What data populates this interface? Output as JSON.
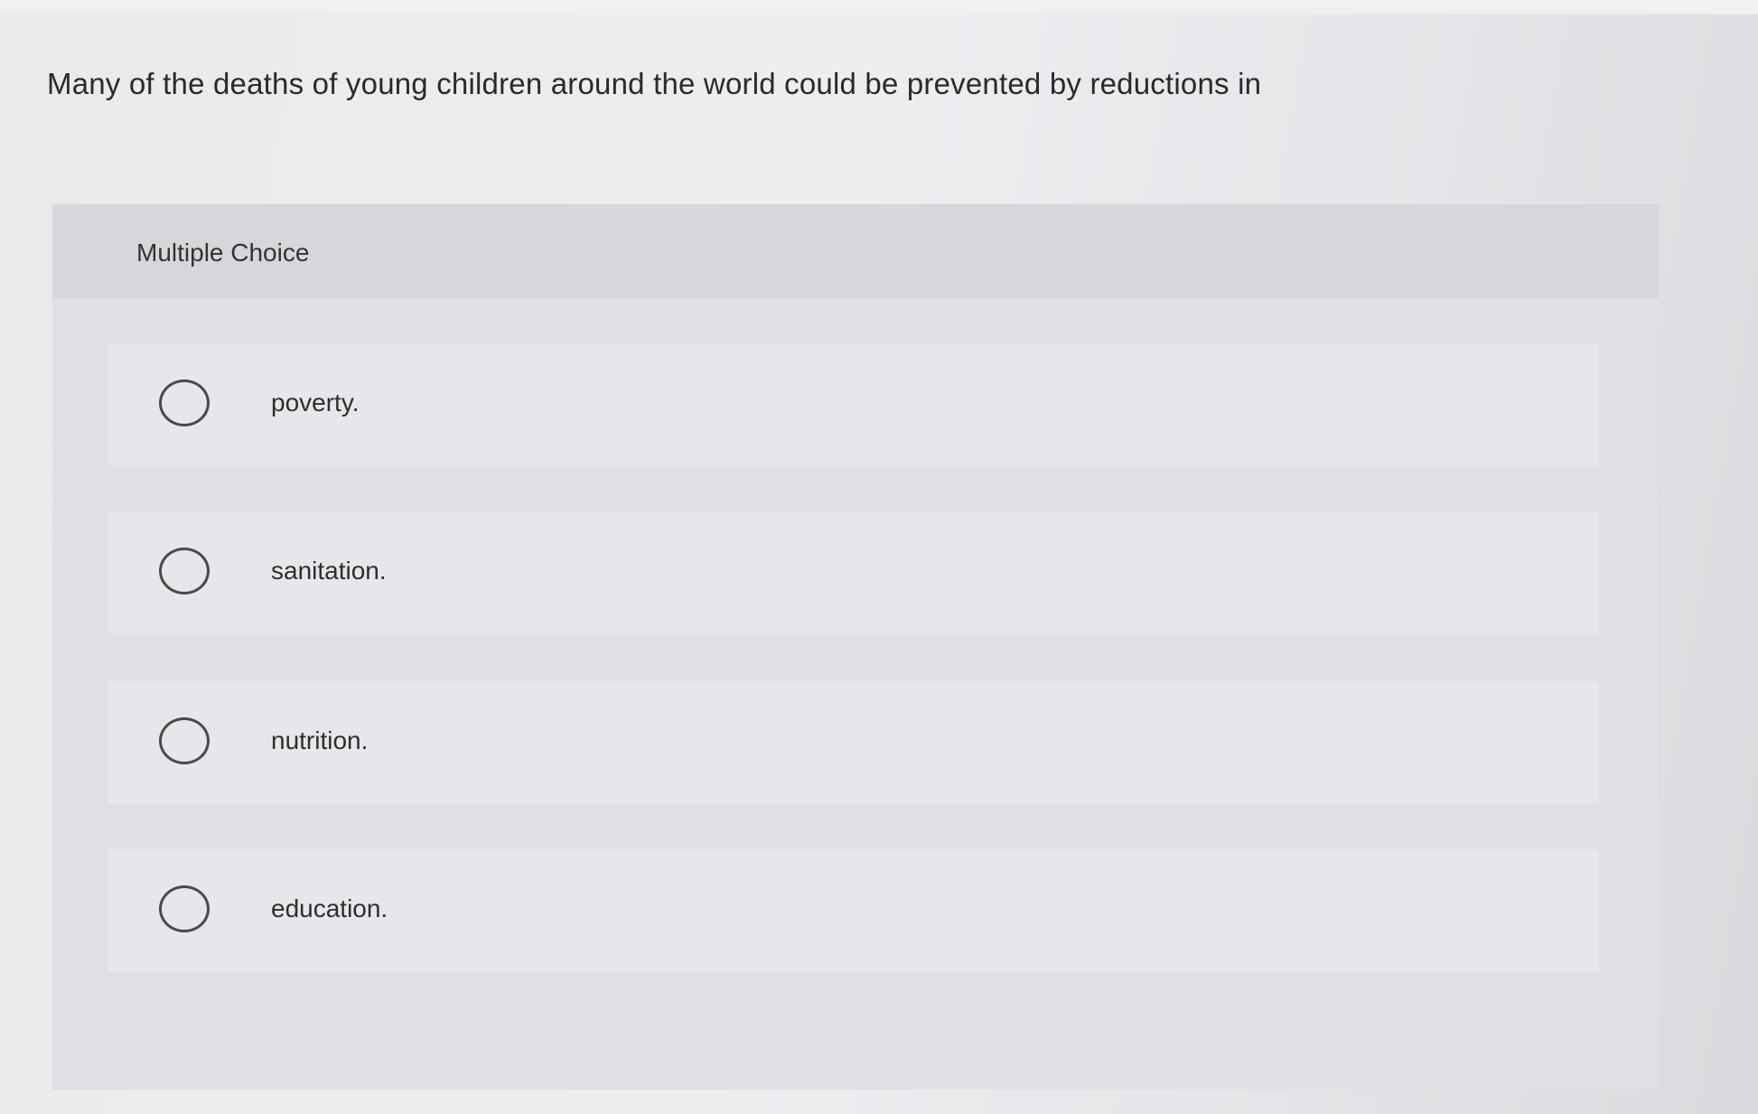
{
  "question": {
    "text": "Many of the deaths of young children around the world could be prevented by reductions in"
  },
  "mc": {
    "header_label": "Multiple Choice",
    "options": [
      {
        "label": "poverty."
      },
      {
        "label": "sanitation."
      },
      {
        "label": "nutrition."
      },
      {
        "label": "education."
      }
    ]
  },
  "icons": {
    "radio": "radio-unselected-icon"
  },
  "colors": {
    "background": "#e9eaec",
    "panel": "#dcdde0",
    "option_row": "#e6e7ea",
    "text": "#2b2b2b"
  }
}
